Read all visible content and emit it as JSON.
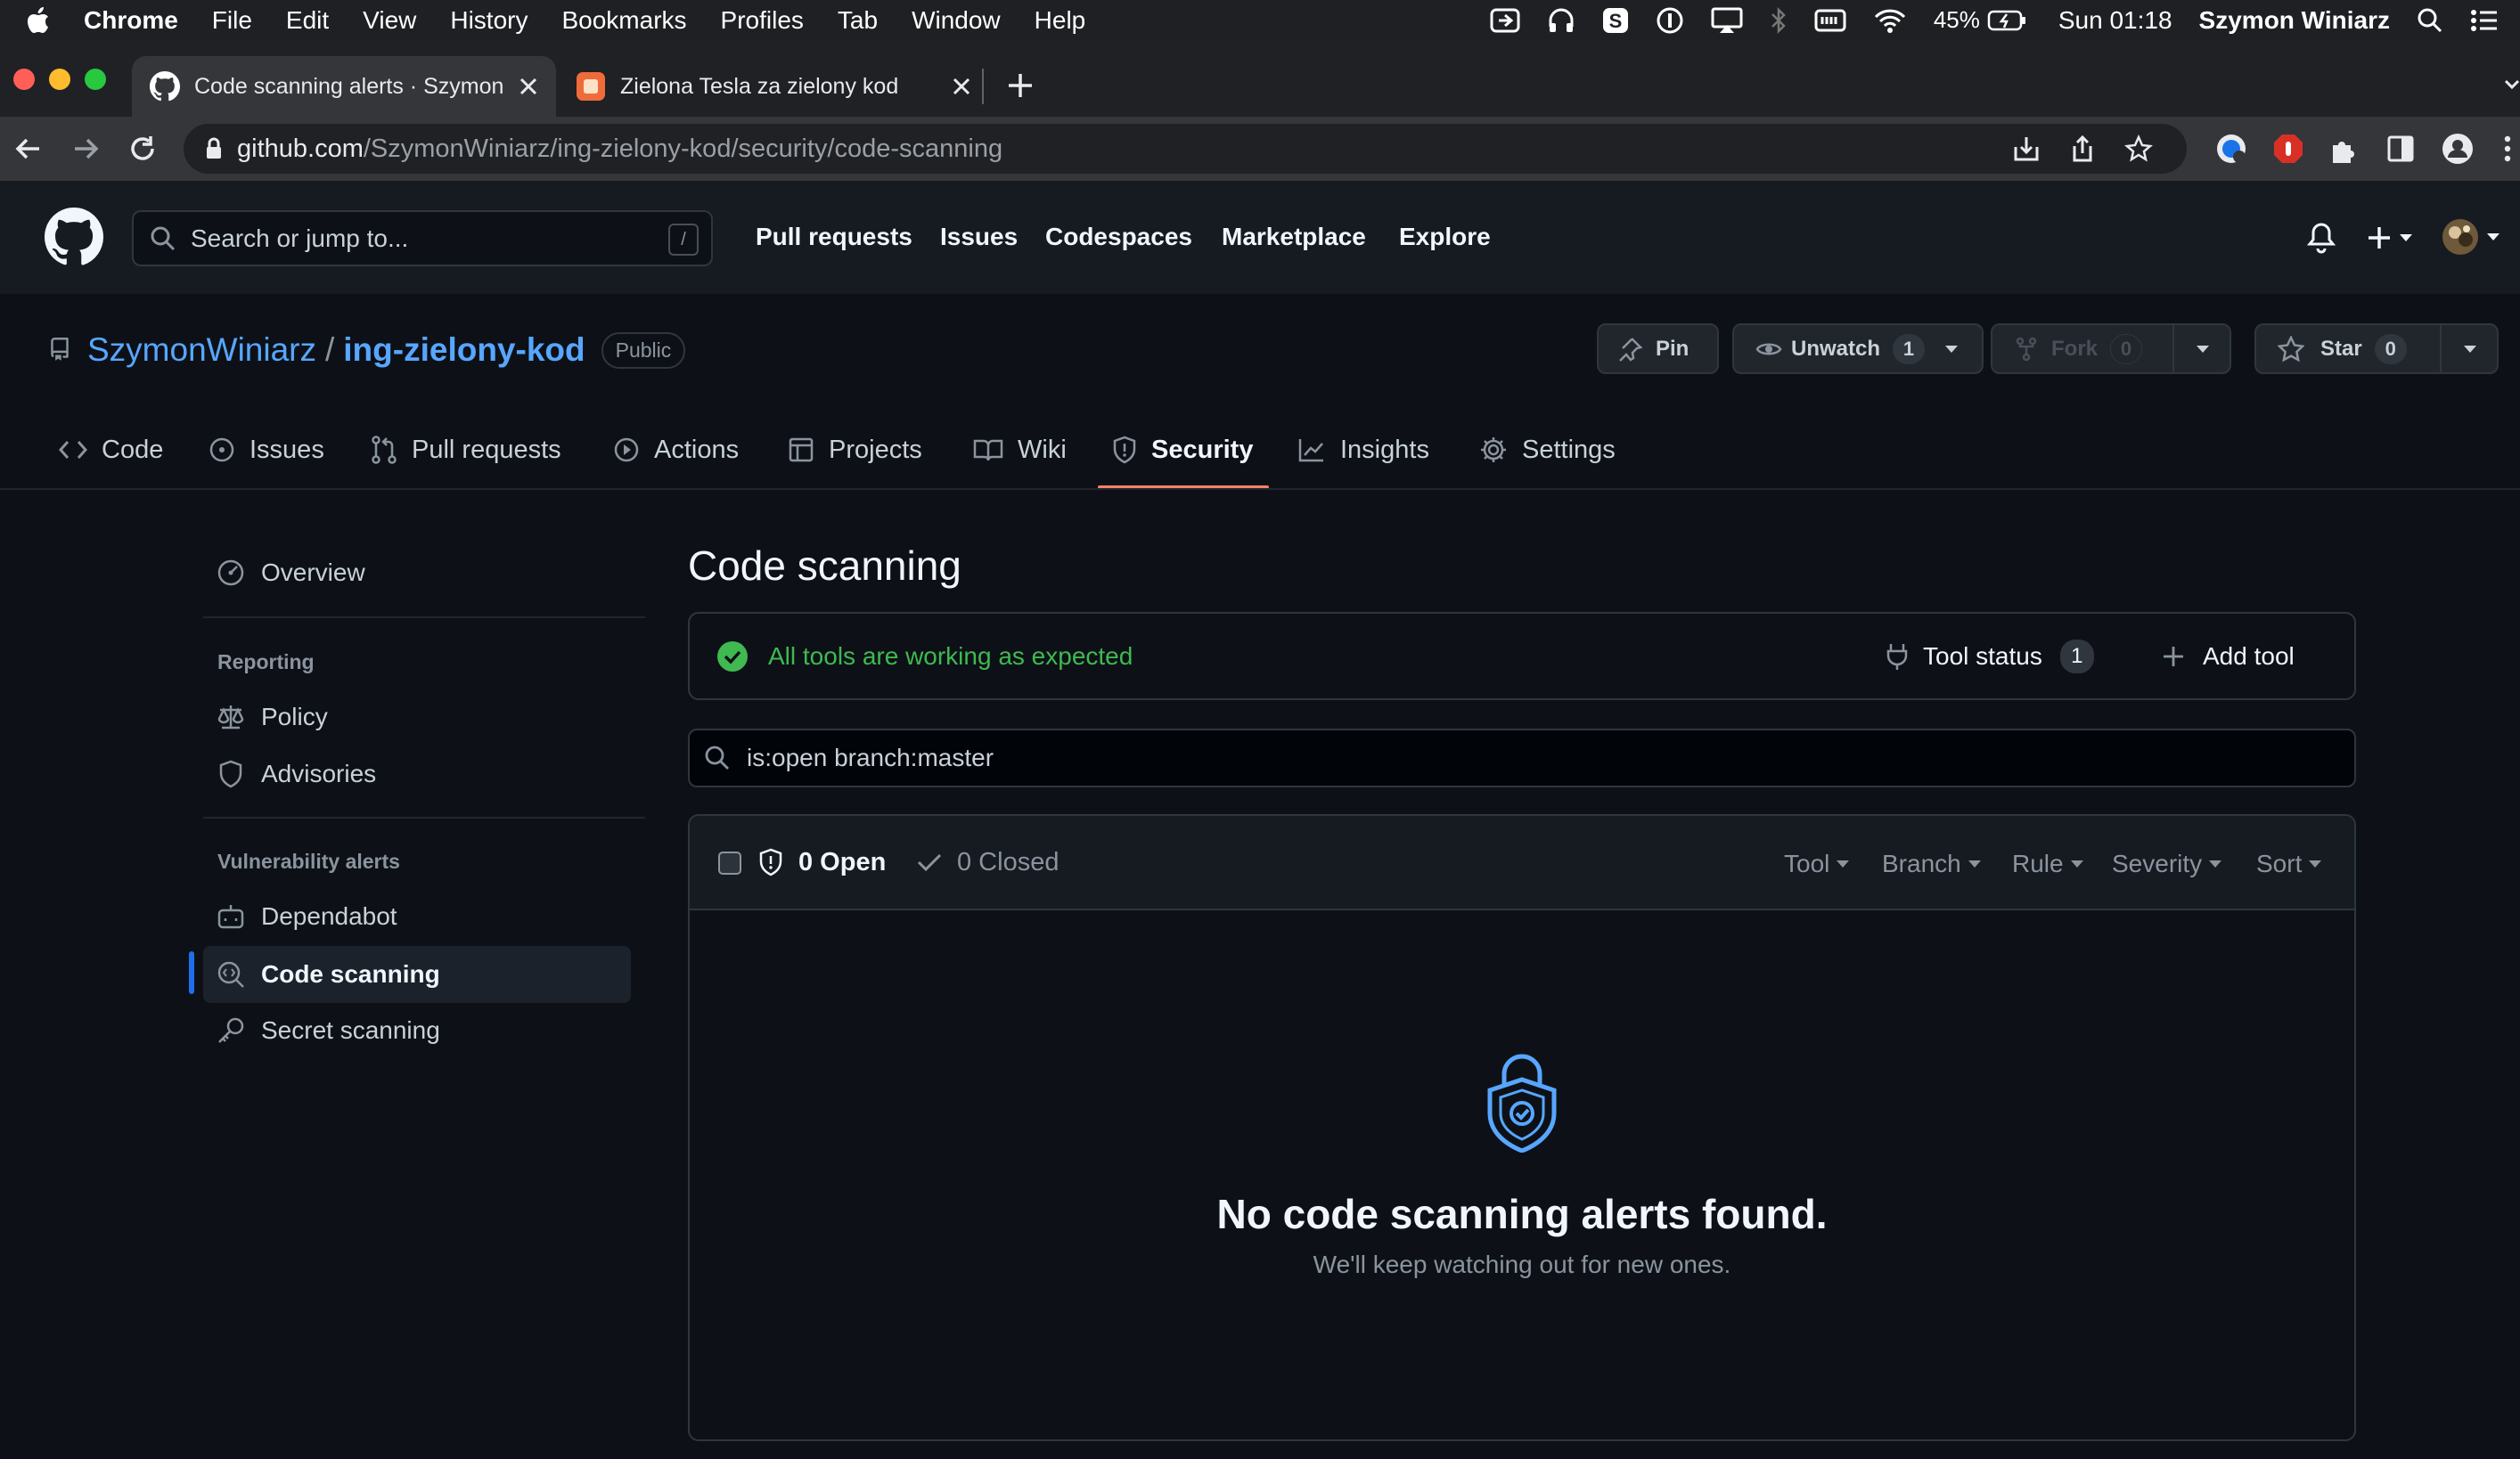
{
  "menubar": {
    "app_name": "Chrome",
    "items": [
      "File",
      "Edit",
      "View",
      "History",
      "Bookmarks",
      "Profiles",
      "Tab",
      "Window",
      "Help"
    ],
    "battery": "45%",
    "clock": "Sun 01:18",
    "user": "Szymon Winiarz"
  },
  "browser": {
    "tabs": [
      {
        "title": "Code scanning alerts · Szymon",
        "active": true
      },
      {
        "title": "Zielona Tesla za zielony kod",
        "active": false
      }
    ],
    "url_host": "github.com",
    "url_path": "/SzymonWiniarz/ing-zielony-kod/security/code-scanning"
  },
  "github_header": {
    "search_placeholder": "Search or jump to...",
    "search_shortcut": "/",
    "nav": [
      "Pull requests",
      "Issues",
      "Codespaces",
      "Marketplace",
      "Explore"
    ]
  },
  "repo": {
    "owner": "SzymonWiniarz",
    "separator": "/",
    "name": "ing-zielony-kod",
    "visibility": "Public",
    "pin_label": "Pin",
    "unwatch_label": "Unwatch",
    "watch_count": "1",
    "fork_label": "Fork",
    "fork_count": "0",
    "star_label": "Star",
    "star_count": "0",
    "tabs": [
      {
        "label": "Code",
        "icon": "code-icon"
      },
      {
        "label": "Issues",
        "icon": "issue-icon"
      },
      {
        "label": "Pull requests",
        "icon": "pull-request-icon"
      },
      {
        "label": "Actions",
        "icon": "play-icon"
      },
      {
        "label": "Projects",
        "icon": "table-icon"
      },
      {
        "label": "Wiki",
        "icon": "book-icon"
      },
      {
        "label": "Security",
        "icon": "shield-icon",
        "selected": true
      },
      {
        "label": "Insights",
        "icon": "graph-icon"
      },
      {
        "label": "Settings",
        "icon": "gear-icon"
      }
    ]
  },
  "sidebar": {
    "overview": "Overview",
    "reporting_header": "Reporting",
    "policy": "Policy",
    "advisories": "Advisories",
    "vuln_header": "Vulnerability alerts",
    "dependabot": "Dependabot",
    "code_scanning": "Code scanning",
    "secret_scanning": "Secret scanning"
  },
  "main": {
    "title": "Code scanning",
    "tools_status_text": "All tools are working as expected",
    "tool_status_label": "Tool status",
    "tool_status_count": "1",
    "add_tool_label": "Add tool",
    "filter_value": "is:open branch:master",
    "open_label": "0 Open",
    "closed_label": "0 Closed",
    "filters": [
      "Tool",
      "Branch",
      "Rule",
      "Severity",
      "Sort"
    ],
    "empty_title": "No code scanning alerts found.",
    "empty_subtitle": "We'll keep watching out for new ones."
  },
  "colors": {
    "accent_link": "#58a6ff",
    "success": "#3fb950",
    "selected_tab_underline": "#f78166",
    "sidebar_active_bar": "#1f6feb",
    "background": "#0d1117"
  }
}
